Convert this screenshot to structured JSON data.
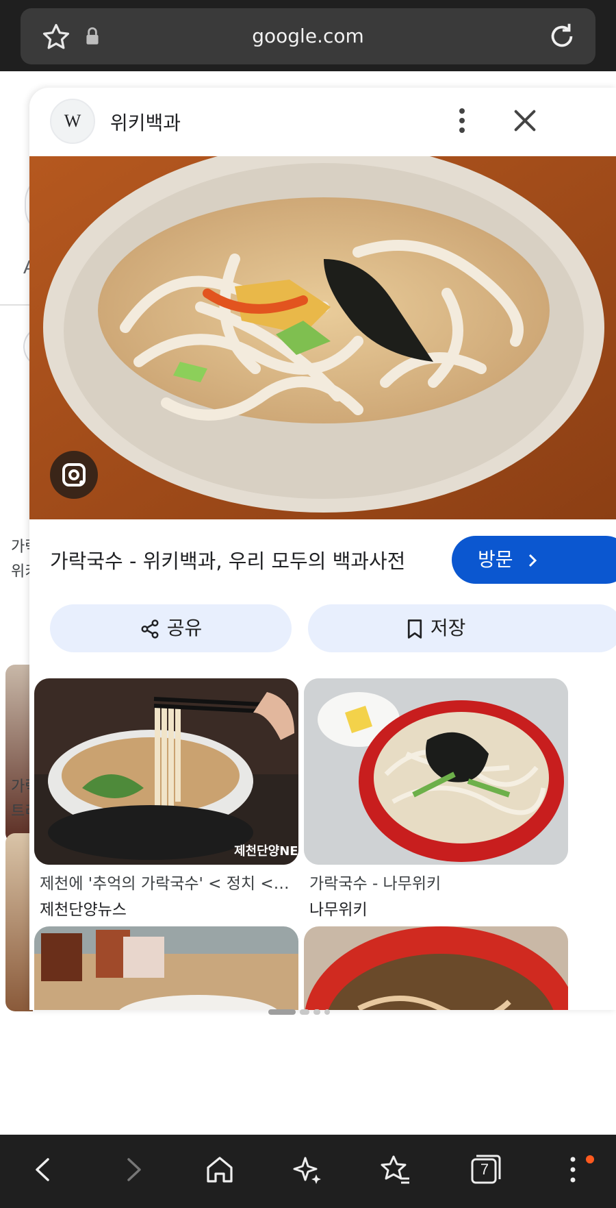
{
  "browser": {
    "url": "google.com",
    "tab_count": "7"
  },
  "background": {
    "left_letter": "A",
    "frag1a": "가락",
    "frag1b": "위키",
    "frag2a": "가락",
    "frag2b": "트리"
  },
  "card": {
    "site_name": "위키백과",
    "favicon_letter": "W",
    "title": "가락국수 - 위키백과, 우리 모두의 백과사전",
    "visit_label": "방문",
    "share_label": "공유",
    "save_label": "저장",
    "related": [
      {
        "caption": "제천에 '추억의 가락국수' < 정치 < 뉴...",
        "source": "제천단양뉴스",
        "watermark": "제천단양NEWS"
      },
      {
        "caption": "가락국수 - 나무위키",
        "source": "나무위키"
      }
    ]
  },
  "colors": {
    "accent": "#0b57d0",
    "tonal_button": "#e8effd",
    "bar": "#1f1f1f",
    "notification": "#ff5a1f"
  },
  "icons": [
    "star-icon",
    "lock-icon",
    "reload-icon",
    "more-vert-icon",
    "close-icon",
    "google-lens-icon",
    "share-icon",
    "bookmark-icon",
    "chevron-right-icon",
    "back-icon",
    "forward-icon",
    "home-icon",
    "sparkle-icon",
    "favorites-icon",
    "tabs-icon",
    "menu-icon"
  ]
}
